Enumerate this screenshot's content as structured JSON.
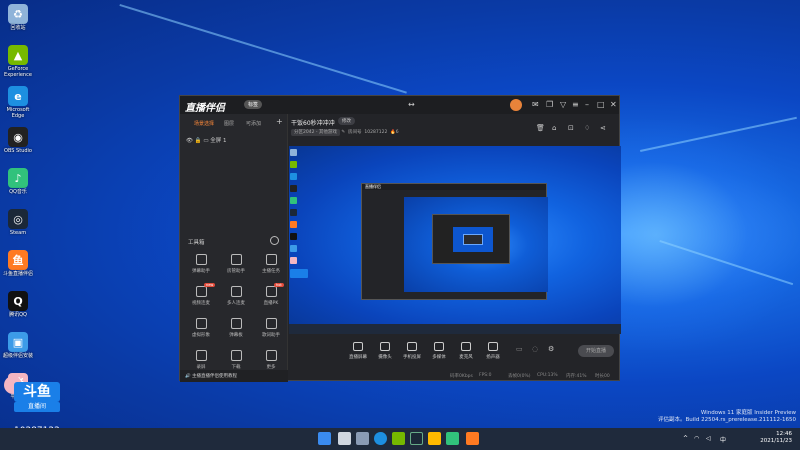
{
  "desktop": {
    "icons": [
      {
        "label": "回收站",
        "color": "#8fb3d9",
        "glyph": "♻"
      },
      {
        "label": "GeForce Experience",
        "color": "#76b900",
        "glyph": "▲"
      },
      {
        "label": "Microsoft Edge",
        "color": "#1d8fe1",
        "glyph": "e"
      },
      {
        "label": "OBS Studio",
        "color": "#222222",
        "glyph": "◉"
      },
      {
        "label": "QQ音乐",
        "color": "#31c27c",
        "glyph": "♪"
      },
      {
        "label": "Steam",
        "color": "#1b2838",
        "glyph": "◎"
      },
      {
        "label": "斗鱼直播伴侣",
        "color": "#ff7a22",
        "glyph": "鱼"
      },
      {
        "label": "腾讯QQ",
        "color": "#111111",
        "glyph": "Q"
      },
      {
        "label": "超级伴侣安装",
        "color": "#3c9be8",
        "glyph": "▣"
      },
      {
        "label": "平常心",
        "color": "#f4b6c2",
        "glyph": "猪"
      }
    ],
    "brand_main": "斗鱼",
    "brand_sub": "直播间",
    "room_id": "10287122",
    "watermark": {
      "line1": "Windows 11 家庭版 Insider Preview",
      "line2": "评估副本。Build 22504.rs_prerelease.211112-1650"
    }
  },
  "taskbar": {
    "time": "12:46",
    "date": "2021/11/23",
    "tray_lang": "中",
    "tray_chevron": "^"
  },
  "app": {
    "logo": "直播伴侣",
    "badge": "标签",
    "sidebar": {
      "tabs": [
        "场景选择",
        "图层",
        "可添加"
      ],
      "scene_name": "全屏 1",
      "toolbox_title": "工具箱",
      "tools": [
        {
          "label": "弹幕助手"
        },
        {
          "label": "房管助手"
        },
        {
          "label": "主播任务"
        },
        {
          "label": "视频连麦",
          "hot": "new"
        },
        {
          "label": "多人连麦"
        },
        {
          "label": "直播PK",
          "hot": "hot"
        },
        {
          "label": "虚拟形象"
        },
        {
          "label": "弹幕板"
        },
        {
          "label": "歌词助手"
        },
        {
          "label": "录屏"
        },
        {
          "label": "下载"
        },
        {
          "label": "更多"
        }
      ],
      "notice": "主播直播伴侣使用教程"
    },
    "room": {
      "title": "干饭60秒冲冲冲",
      "edit_label": "修改",
      "category": "分区2042 - 其他游戏",
      "room_label": "房间号",
      "room_number": "10287122",
      "viewers": "6"
    },
    "controls": [
      {
        "label": "直播屏幕"
      },
      {
        "label": "摄像头"
      },
      {
        "label": "手机投屏"
      },
      {
        "label": "多媒体"
      },
      {
        "label": "麦克风"
      },
      {
        "label": "扬声器"
      }
    ],
    "start_label": "开始直播",
    "stats": [
      "码率0Kbps",
      "FPS:0",
      "丢帧0(0%)",
      "CPU:13%",
      "内存:41%",
      "时长00"
    ]
  }
}
